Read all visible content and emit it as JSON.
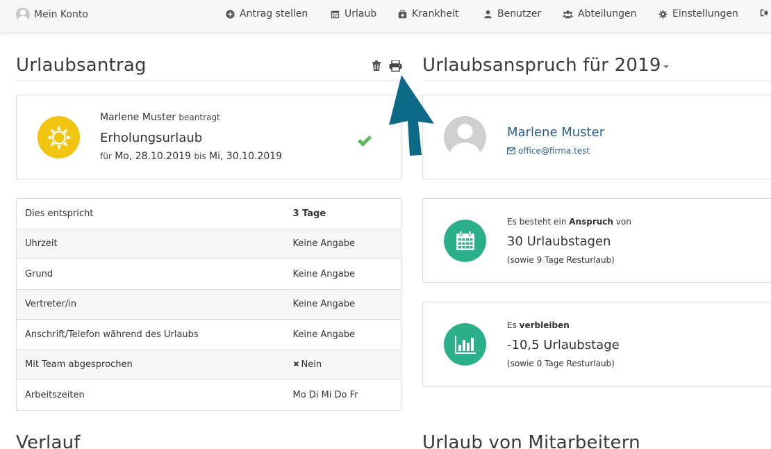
{
  "nav": {
    "account": "Mein Konto",
    "items": [
      {
        "label": "Antrag stellen",
        "icon": "plus-circle-icon"
      },
      {
        "label": "Urlaub",
        "icon": "calendar-icon"
      },
      {
        "label": "Krankheit",
        "icon": "medkit-icon"
      },
      {
        "label": "Benutzer",
        "icon": "user-icon"
      },
      {
        "label": "Abteilungen",
        "icon": "users-icon"
      },
      {
        "label": "Einstellungen",
        "icon": "gear-icon"
      }
    ]
  },
  "request": {
    "title": "Urlaubsantrag",
    "applicant": "Marlene Muster",
    "applied_label": "beantragt",
    "type": "Erholungsurlaub",
    "for_label": "für",
    "from": "Mo, 28.10.2019",
    "until_label": "bis",
    "to": "Mi, 30.10.2019",
    "details": [
      {
        "key": "Dies entspricht",
        "value": "3 Tage"
      },
      {
        "key": "Uhrzeit",
        "value": "Keine Angabe"
      },
      {
        "key": "Grund",
        "value": "Keine Angabe"
      },
      {
        "key": "Vertreter/in",
        "value": "Keine Angabe"
      },
      {
        "key": "Anschrift/Telefon während des Urlaubs",
        "value": "Keine Angabe"
      },
      {
        "key": "Mit Team abgesprochen",
        "value": "Nein"
      },
      {
        "key": "Arbeitszeiten",
        "value": "Mo Di Mi Do Fr"
      }
    ]
  },
  "entitlement": {
    "title": "Urlaubsanspruch für 2019",
    "person_name": "Marlene Muster",
    "email": "office@firma.test",
    "claim_prefix": "Es besteht ein",
    "claim_bold": "Anspruch",
    "claim_suffix": "von",
    "claim_value": "30 Urlaubstagen",
    "claim_note": "(sowie 9 Tage Resturlaub)",
    "remain_prefix": "Es",
    "remain_bold": "verbleiben",
    "remain_value": "-10,5 Urlaubstage",
    "remain_note": "(sowie 0 Tage Resturlaub)"
  },
  "sections": {
    "history": "Verlauf",
    "colleagues": "Urlaub von Mitarbeitern"
  },
  "colors": {
    "accent_green": "#2bb08a",
    "sun_yellow": "#f1c40f",
    "check_green": "#5cb85c",
    "link_blue": "#285e8e",
    "arrow_teal": "#0d6a86"
  }
}
